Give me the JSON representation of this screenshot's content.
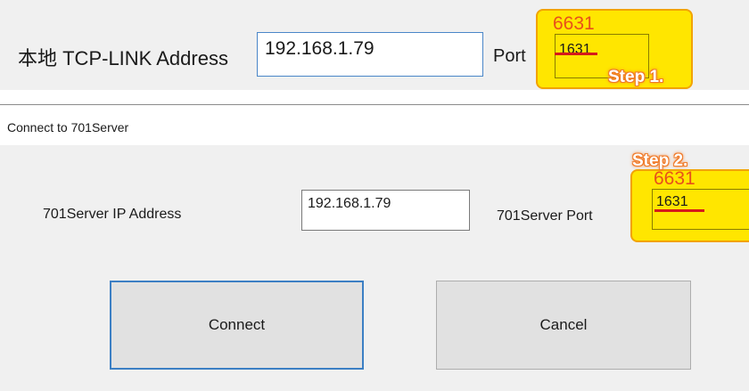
{
  "tcp_link": {
    "label": "本地 TCP-LINK Address",
    "ip_value": "192.168.1.79",
    "port_label": "Port",
    "port_old_value": "1631",
    "port_new_value": "6631",
    "step_label": "Step 1."
  },
  "connect_dialog": {
    "title": "Connect to 701Server",
    "ip_label": "701Server IP Address",
    "ip_value": "192.168.1.79",
    "port_label": "701Server Port",
    "port_old_value": "1631",
    "port_new_value": "6631",
    "step_label": "Step 2.",
    "connect_label": "Connect",
    "cancel_label": "Cancel"
  },
  "colors": {
    "highlight": "#ffe600",
    "annotation_text": "#e8501a",
    "strike": "#d61a1a",
    "step_badge": "#f07a28",
    "focus_border": "#3c7fc4"
  }
}
